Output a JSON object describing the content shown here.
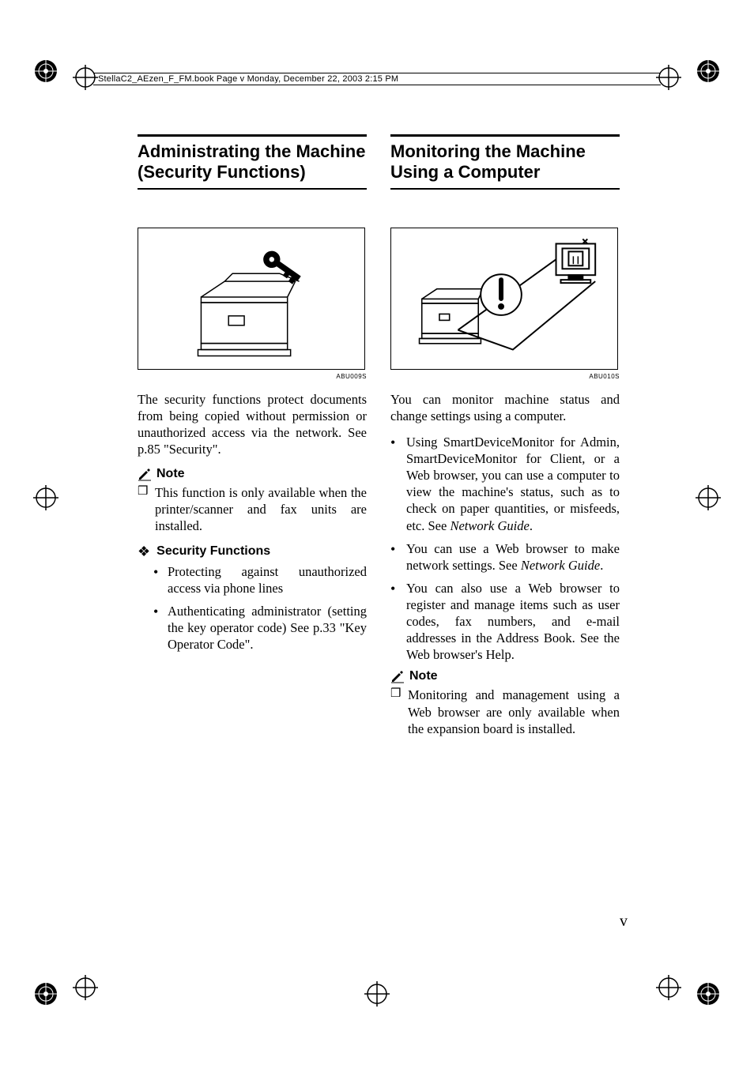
{
  "header_line": "StellaC2_AEzen_F_FM.book  Page v  Monday, December 22, 2003  2:15 PM",
  "page_number": "v",
  "left": {
    "title": "Administrating the Machine (Security Functions)",
    "fig_caption": "ABU009S",
    "body": "The security functions protect documents from being copied without permission or unauthorized access via the network. See p.85 \"Security\".",
    "note_label": "Note",
    "note_items": [
      "This function is only available when the printer/scanner and fax units are installed."
    ],
    "sub_label": "Security Functions",
    "sub_items": [
      "Protecting against unauthorized access via phone lines",
      "Authenticating administrator (setting the key operator code) See p.33 \"Key Operator Code\"."
    ]
  },
  "right": {
    "title": "Monitoring the Machine Using a Computer",
    "fig_caption": "ABU010S",
    "body": "You can monitor machine status and change settings using a computer.",
    "bullets": [
      {
        "pre": "Using SmartDeviceMonitor for Admin, SmartDeviceMonitor for Client, or a Web browser, you can use a computer to view the machine's status, such as to check on paper quantities, or misfeeds, etc. See ",
        "italic": "Network Guide",
        "post": "."
      },
      {
        "pre": "You can use a Web browser to make network settings. See ",
        "italic": "Network Guide",
        "post": "."
      },
      {
        "pre": "You can also use a Web browser to register and manage items such as user codes, fax numbers, and e-mail addresses in the Address Book. See the Web browser's Help.",
        "italic": "",
        "post": ""
      }
    ],
    "note_label": "Note",
    "note_items": [
      "Monitoring and management using a Web browser are only available when the expansion board is installed."
    ]
  }
}
